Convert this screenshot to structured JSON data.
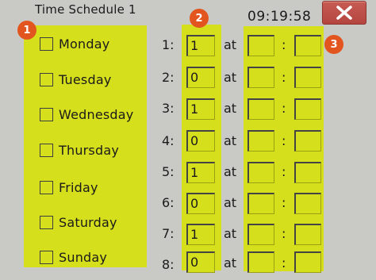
{
  "window": {
    "title": "Time Schedule 1",
    "clock": "09:19:58",
    "close_icon": "close-x-icon"
  },
  "badges": [
    "1",
    "2",
    "3"
  ],
  "days": [
    {
      "label": "Monday",
      "checked": false
    },
    {
      "label": "Tuesday",
      "checked": false
    },
    {
      "label": "Wednesday",
      "checked": false
    },
    {
      "label": "Thursday",
      "checked": false
    },
    {
      "label": "Friday",
      "checked": false
    },
    {
      "label": "Saturday",
      "checked": false
    },
    {
      "label": "Sunday",
      "checked": false
    }
  ],
  "schedule": {
    "at_label": "at",
    "colon": ":",
    "rows": [
      {
        "number": "1:",
        "count": "1",
        "hour": "",
        "minute": ""
      },
      {
        "number": "2:",
        "count": "0",
        "hour": "",
        "minute": ""
      },
      {
        "number": "3:",
        "count": "1",
        "hour": "",
        "minute": ""
      },
      {
        "number": "4:",
        "count": "0",
        "hour": "",
        "minute": ""
      },
      {
        "number": "5:",
        "count": "1",
        "hour": "",
        "minute": ""
      },
      {
        "number": "6:",
        "count": "0",
        "hour": "",
        "minute": ""
      },
      {
        "number": "7:",
        "count": "1",
        "hour": "",
        "minute": ""
      },
      {
        "number": "8:",
        "count": "0",
        "hour": "",
        "minute": ""
      }
    ]
  },
  "colors": {
    "background": "#c9cac6",
    "highlight": "#d6df1c",
    "badge": "#e2551f",
    "close_button": "#b4463f"
  }
}
